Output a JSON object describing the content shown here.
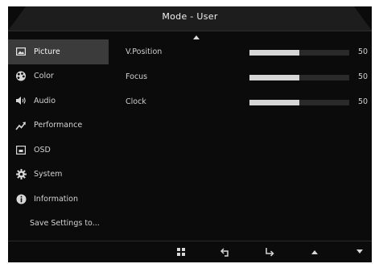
{
  "header": {
    "title": "Mode - User"
  },
  "sidebar": {
    "items": [
      {
        "label": "Picture",
        "icon": "picture-icon",
        "active": true
      },
      {
        "label": "Color",
        "icon": "color-palette-icon"
      },
      {
        "label": "Audio",
        "icon": "speaker-icon"
      },
      {
        "label": "Performance",
        "icon": "performance-arrow-icon"
      },
      {
        "label": "OSD",
        "icon": "osd-icon"
      },
      {
        "label": "System",
        "icon": "gear-icon"
      },
      {
        "label": "Information",
        "icon": "info-icon"
      }
    ],
    "save_label": "Save Settings to..."
  },
  "settings": [
    {
      "label": "V.Position",
      "value": "50",
      "level": 0.5
    },
    {
      "label": "Focus",
      "value": "50",
      "level": 0.5
    },
    {
      "label": "Clock",
      "value": "50",
      "level": 0.5
    }
  ],
  "footer": {
    "buttons": [
      "menu-grid-icon",
      "back-icon",
      "enter-icon",
      "up-arrow-icon",
      "down-arrow-icon"
    ]
  },
  "colors": {
    "background": "#0b0b0b",
    "active_item": "#3b3b3b",
    "bar_fill": "#d6d6d6",
    "text": "#d0d0d0"
  }
}
